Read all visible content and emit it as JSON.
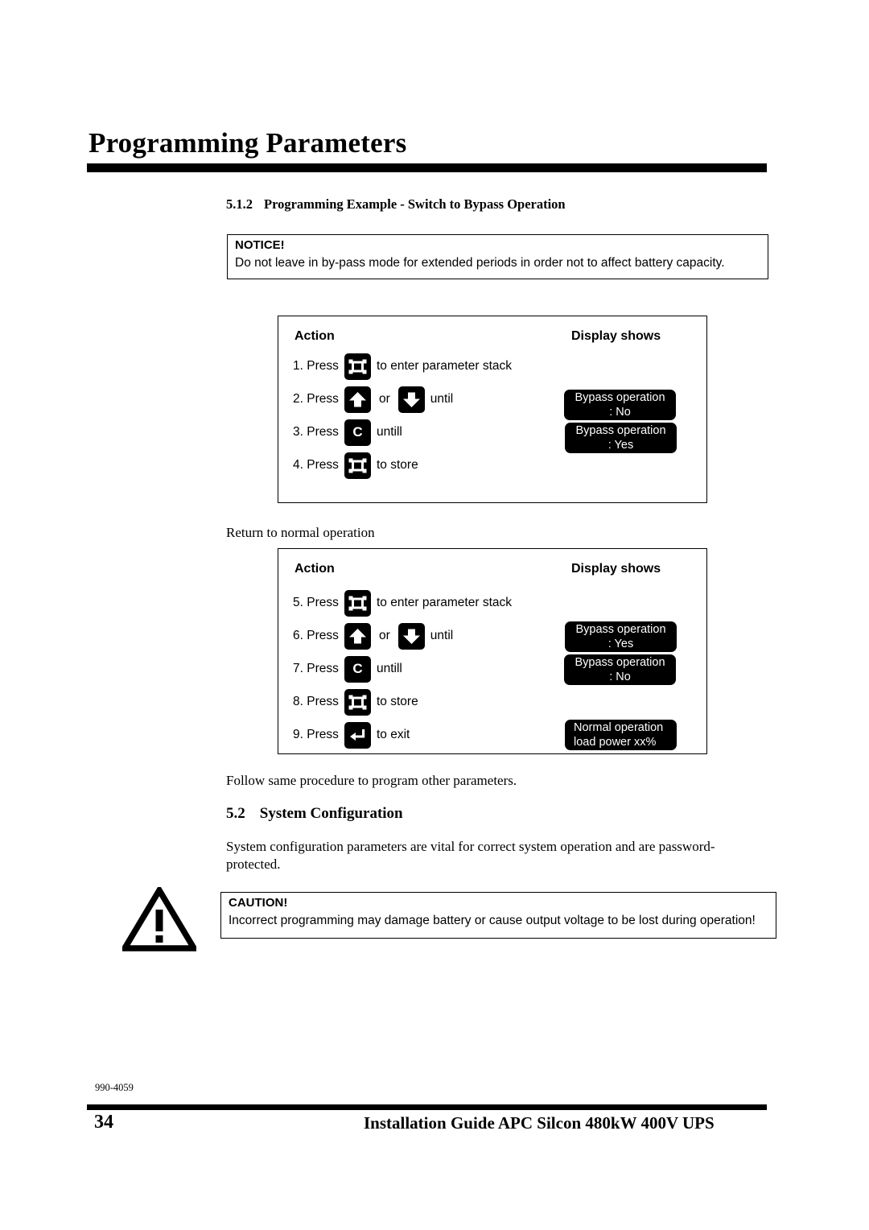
{
  "page": {
    "title": "Programming Parameters",
    "subsection_512": {
      "number": "5.1.2",
      "heading": "Programming Example - Switch to Bypass Operation"
    },
    "subsection_52": {
      "number": "5.2",
      "heading": "System Configuration"
    }
  },
  "notice": {
    "label": "NOTICE!",
    "text": "Do not leave in by-pass mode for extended periods in order not to affect battery capacity."
  },
  "caution": {
    "label": "CAUTION!",
    "text": "Incorrect programming may damage battery or cause output voltage to be lost during operation!"
  },
  "paragraphs": {
    "return_to_normal": "Return to normal operation",
    "follow_same": "Follow same procedure to program other parameters.",
    "system_config": "System configuration parameters are vital for correct system operation and are password-protected."
  },
  "table1": {
    "col_action": "Action",
    "col_display": "Display shows",
    "rows": [
      {
        "press": "1. Press",
        "key": "parameter-stack-key",
        "key_label": "",
        "after": "to enter parameter stack",
        "mid": "",
        "key2": "",
        "after2": ""
      },
      {
        "press": "2. Press",
        "key": "up-arrow-key",
        "key_label": "",
        "mid": "or",
        "key2": "down-arrow-key",
        "after2": "until",
        "after": ""
      },
      {
        "press": "3. Press",
        "key": "c-key",
        "key_label": "C",
        "after": "untill",
        "mid": "",
        "key2": "",
        "after2": ""
      },
      {
        "press": "4. Press",
        "key": "parameter-stack-key",
        "key_label": "",
        "after": "to store",
        "mid": "",
        "key2": "",
        "after2": ""
      }
    ],
    "displays": [
      {
        "line1": "Bypass operation",
        "line2": ": No"
      },
      {
        "line1": "Bypass operation",
        "line2": ": Yes"
      }
    ]
  },
  "table2": {
    "col_action": "Action",
    "col_display": "Display shows",
    "rows": [
      {
        "press": "5. Press",
        "key": "parameter-stack-key",
        "key_label": "",
        "after": "to enter parameter stack",
        "mid": "",
        "key2": "",
        "after2": ""
      },
      {
        "press": "6. Press",
        "key": "up-arrow-key",
        "key_label": "",
        "mid": "or",
        "key2": "down-arrow-key",
        "after2": "until",
        "after": ""
      },
      {
        "press": "7. Press",
        "key": "c-key",
        "key_label": "C",
        "after": "untill",
        "mid": "",
        "key2": "",
        "after2": ""
      },
      {
        "press": "8. Press",
        "key": "parameter-stack-key",
        "key_label": "",
        "after": "to store",
        "mid": "",
        "key2": "",
        "after2": ""
      },
      {
        "press": "9. Press",
        "key": "enter-key",
        "key_label": "",
        "after": "to exit",
        "mid": "",
        "key2": "",
        "after2": ""
      }
    ],
    "displays": [
      {
        "line1": "Bypass operation",
        "line2": ": Yes"
      },
      {
        "line1": "Bypass operation",
        "line2": ": No"
      },
      {
        "line1": "Normal operation",
        "line2": "load power   xx%"
      }
    ]
  },
  "footer": {
    "doc_code": "990-4059",
    "page_number": "34",
    "title": "Installation Guide APC Silcon 480kW 400V UPS"
  },
  "colors": {
    "ink": "#000000",
    "paper": "#ffffff",
    "lcd_background": "#000000",
    "lcd_text": "#ffffff"
  }
}
